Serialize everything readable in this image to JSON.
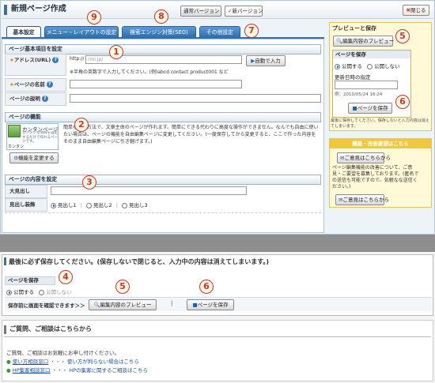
{
  "header": {
    "title": "新規ページ作成",
    "normal_version": "通常バージョン",
    "new_version": "新バージョン",
    "close": "閉じる"
  },
  "tabs": [
    {
      "label": "基本設定"
    },
    {
      "label": "メニュー・レイアウトの設定"
    },
    {
      "label": "検索エンジン対策(SEO)"
    },
    {
      "label": "その他設定"
    }
  ],
  "basic": {
    "section_title": "ページ基本項目を設定",
    "address_label": "アドレス(URL)",
    "address_prefix": "http://",
    "address_domain": "rmi.jp/",
    "auto_input": "自動で入力",
    "address_note": "※半角の英数字で入力してください。(例)abcd  contact  product001  など",
    "page_name_label": "ページの名前",
    "page_desc_label": "ページの説明"
  },
  "features": {
    "section_title": "ページの機能",
    "thumb_title": "カンタンページ",
    "thumb_desc": "カンタンな項目を設定するだけで作れるページです。",
    "thumb_sub": "カンタン",
    "change_button": "機能を変更する",
    "description": "簡単な入力方法で、文章主体のページが作れます。簡単にできる代わりに高度な操作ができません。なんでも自由に使いたい場合は、ページの機能を自由編集ページに変更してください。(一度保存してから変更すると、ここで作った内容をそのまま自由編集ページに引き継げます。)"
  },
  "content": {
    "section_title": "ページの内容を設定",
    "heading_label": "大見出し",
    "decoration_label": "見出し装飾",
    "options": [
      "見出し1",
      "見出し2",
      "見出し3"
    ]
  },
  "sidebar": {
    "preview_title": "プレビューと保存",
    "preview_button": "編集内容のプレビュー",
    "save_title": "ページを保存",
    "publish": "公開する",
    "unpublish": "公開しない",
    "datetime_label": "更新日時の指定",
    "datetime_value": "例：2010/05/24 16:24",
    "save_button": "ページを保存",
    "save_note": "最後に保存してください。保存しないと入力内容は消えてしまいます。",
    "feedback_title": "機能・改善要望はこちら",
    "feedback_button": "ご意見はこちらから",
    "feedback_text": "ページ編集機能の改善について、ご意見・ご要望を募集しております。(匿名での送信も可能ですので、気軽なな送信ください。)",
    "feedback_button2": "ご意見はこちらから"
  },
  "bottom": {
    "notice": "最後に必ず保存してください。(保存しないで閉じると、入力中の内容は消えてしまいます。)",
    "save_title": "ページを保存",
    "publish": "公開する",
    "unpublish": "公開しない",
    "confirm_label": "保存前に画面を確認できます＞＞",
    "preview_button": "編集内容のプレビュー",
    "save_button": "ページを保存"
  },
  "help": {
    "title": "ご質問、ご相談はこちらから",
    "intro": "ご質問、ご相談はお気軽にお申し付けください。",
    "link1": "使い方相談窓口",
    "link1_desc": "使い方が判らない場合はこちら",
    "link2": "HP集客相談窓口",
    "link2_desc": "HPの集客に関するご相談はこちら",
    "dots": "・・・"
  },
  "markers": [
    "1",
    "2",
    "3",
    "4",
    "5",
    "5",
    "6",
    "6",
    "7",
    "8",
    "9"
  ]
}
